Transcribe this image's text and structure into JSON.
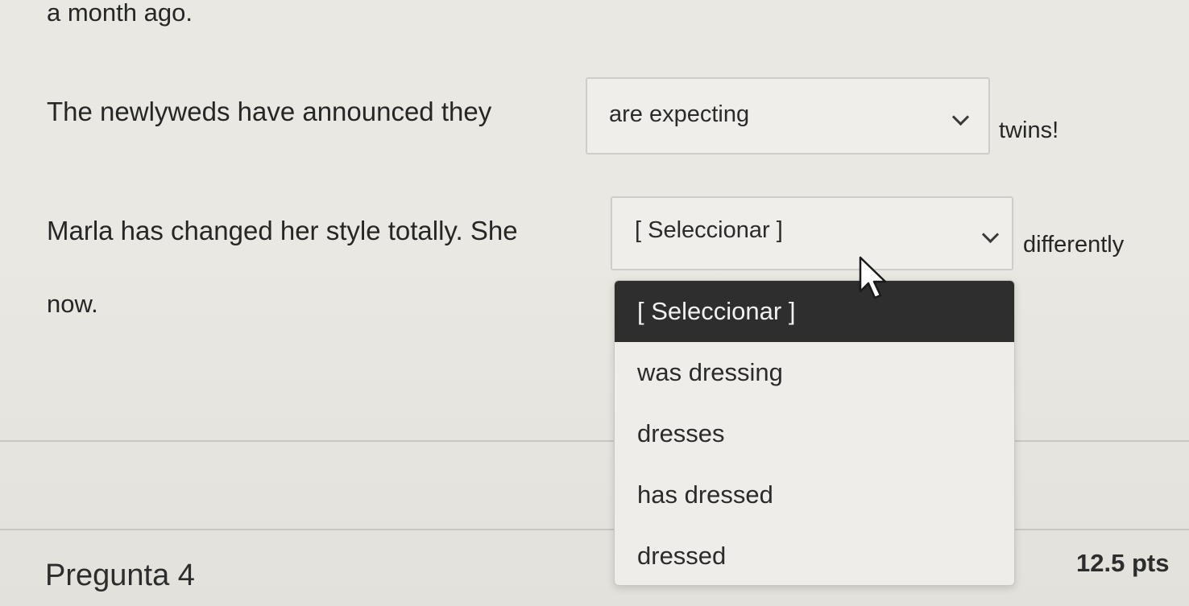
{
  "prev_fragment": "a month ago.",
  "q1": {
    "text_before": "The newlyweds have announced they",
    "selected_value": "are expecting",
    "text_after": "twins!"
  },
  "q2": {
    "text_before": "Marla has changed her style totally. She",
    "selected_value": "[ Seleccionar ]",
    "text_after": "differently",
    "text_wrap": "now."
  },
  "dropdown": {
    "options": [
      {
        "label": "[ Seleccionar ]",
        "selected": true
      },
      {
        "label": "was dressing",
        "selected": false
      },
      {
        "label": "dresses",
        "selected": false
      },
      {
        "label": "has dressed",
        "selected": false
      },
      {
        "label": "dressed",
        "selected": false
      }
    ]
  },
  "next_question": {
    "title": "Pregunta 4",
    "points": "12.5 pts"
  },
  "colors": {
    "background": "#e9e8e2",
    "selected_option_bg": "#2e2e2e",
    "text": "#262626"
  },
  "icons": [
    "chevron-down-icon",
    "mouse-pointer-icon"
  ]
}
